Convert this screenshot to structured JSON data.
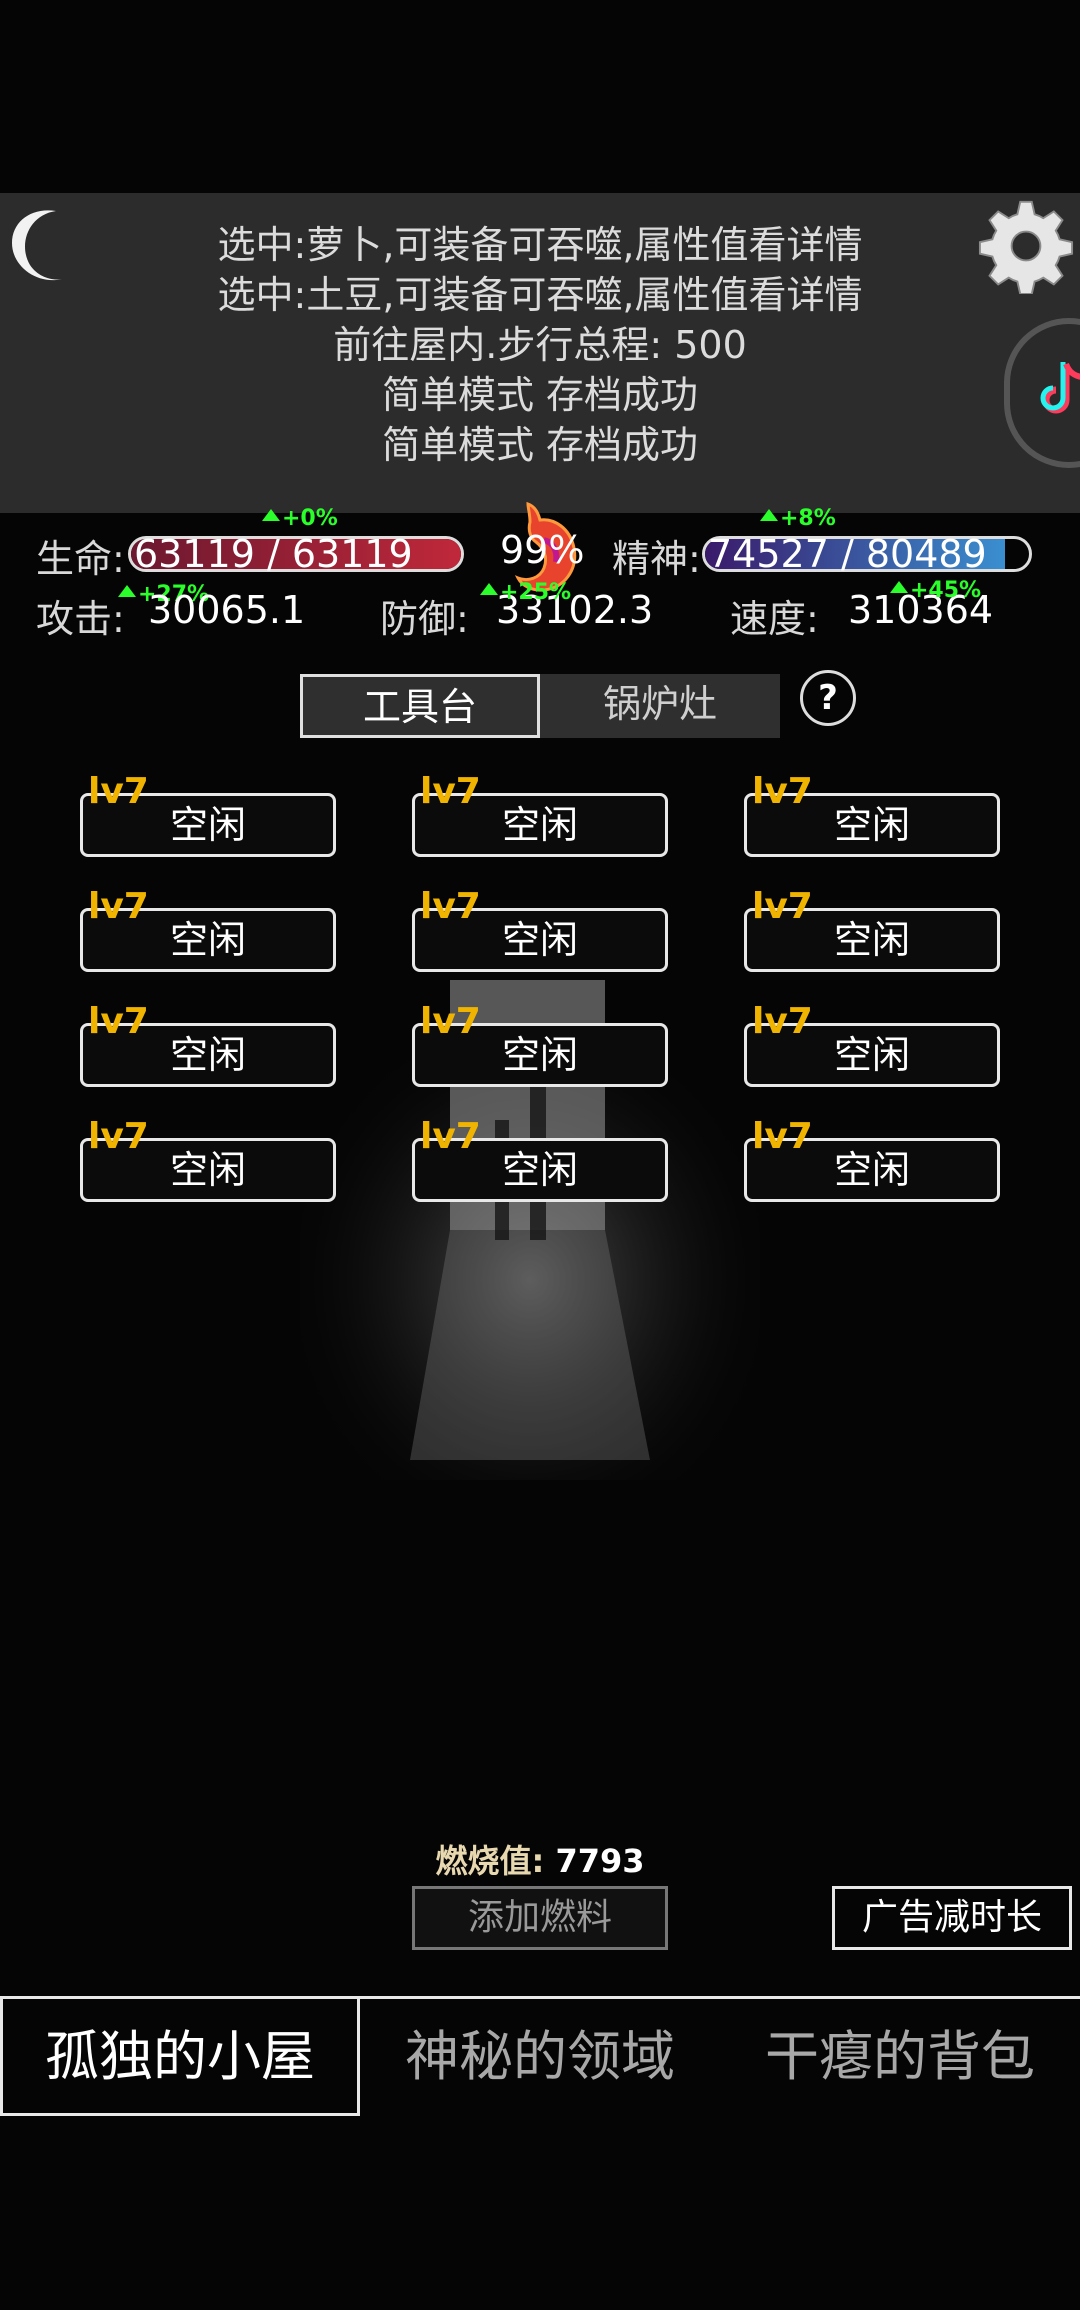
{
  "log": {
    "lines": [
      "选中:萝卜,可装备可吞噬,属性值看详情",
      "选中:土豆,可装备可吞噬,属性值看详情",
      "前往屋内.步行总程: 500",
      "简单模式 存档成功",
      "简单模式 存档成功"
    ]
  },
  "stats": {
    "hp_label": "生命:",
    "hp_value": "63119 / 63119",
    "hp_fraction": 1.0,
    "hp_bonus": "+0%",
    "attack_bonus": "+27%",
    "stomach_value": "99%",
    "spirit_label": "精神:",
    "spirit_value": "74527 / 80489",
    "spirit_fraction": 0.926,
    "spirit_bonus": "+8%",
    "speed_bonus": "+45%",
    "attack_label": "攻击:",
    "attack_value": "30065.1",
    "defense_label": "防御:",
    "defense_value": "33102.3",
    "defense_bonus": "+25%",
    "speed_label": "速度:",
    "speed_value": "310364",
    "colors": {
      "hp": "#c0283a",
      "spirit": "#3a8fd0",
      "bonus": "#2bff2b"
    }
  },
  "tabs": {
    "workbench": "工具台",
    "boiler": "锅炉灶"
  },
  "slots": [
    {
      "level": "lv7",
      "status": "空闲"
    },
    {
      "level": "lv7",
      "status": "空闲"
    },
    {
      "level": "lv7",
      "status": "空闲"
    },
    {
      "level": "lv7",
      "status": "空闲"
    },
    {
      "level": "lv7",
      "status": "空闲"
    },
    {
      "level": "lv7",
      "status": "空闲"
    },
    {
      "level": "lv7",
      "status": "空闲"
    },
    {
      "level": "lv7",
      "status": "空闲"
    },
    {
      "level": "lv7",
      "status": "空闲"
    },
    {
      "level": "lv7",
      "status": "空闲"
    },
    {
      "level": "lv7",
      "status": "空闲"
    },
    {
      "level": "lv7",
      "status": "空闲"
    }
  ],
  "furnace": {
    "burn_label": "燃烧值:",
    "burn_value": "7793",
    "add_fuel": "添加燃料",
    "ad_reduce": "广告减时长"
  },
  "nav": {
    "hut": "孤独的小屋",
    "domain": "神秘的领域",
    "backpack": "干瘪的背包"
  },
  "icons": [
    "moon-icon",
    "gear-icon",
    "help-icon",
    "stomach-icon",
    "tiktok-icon"
  ]
}
